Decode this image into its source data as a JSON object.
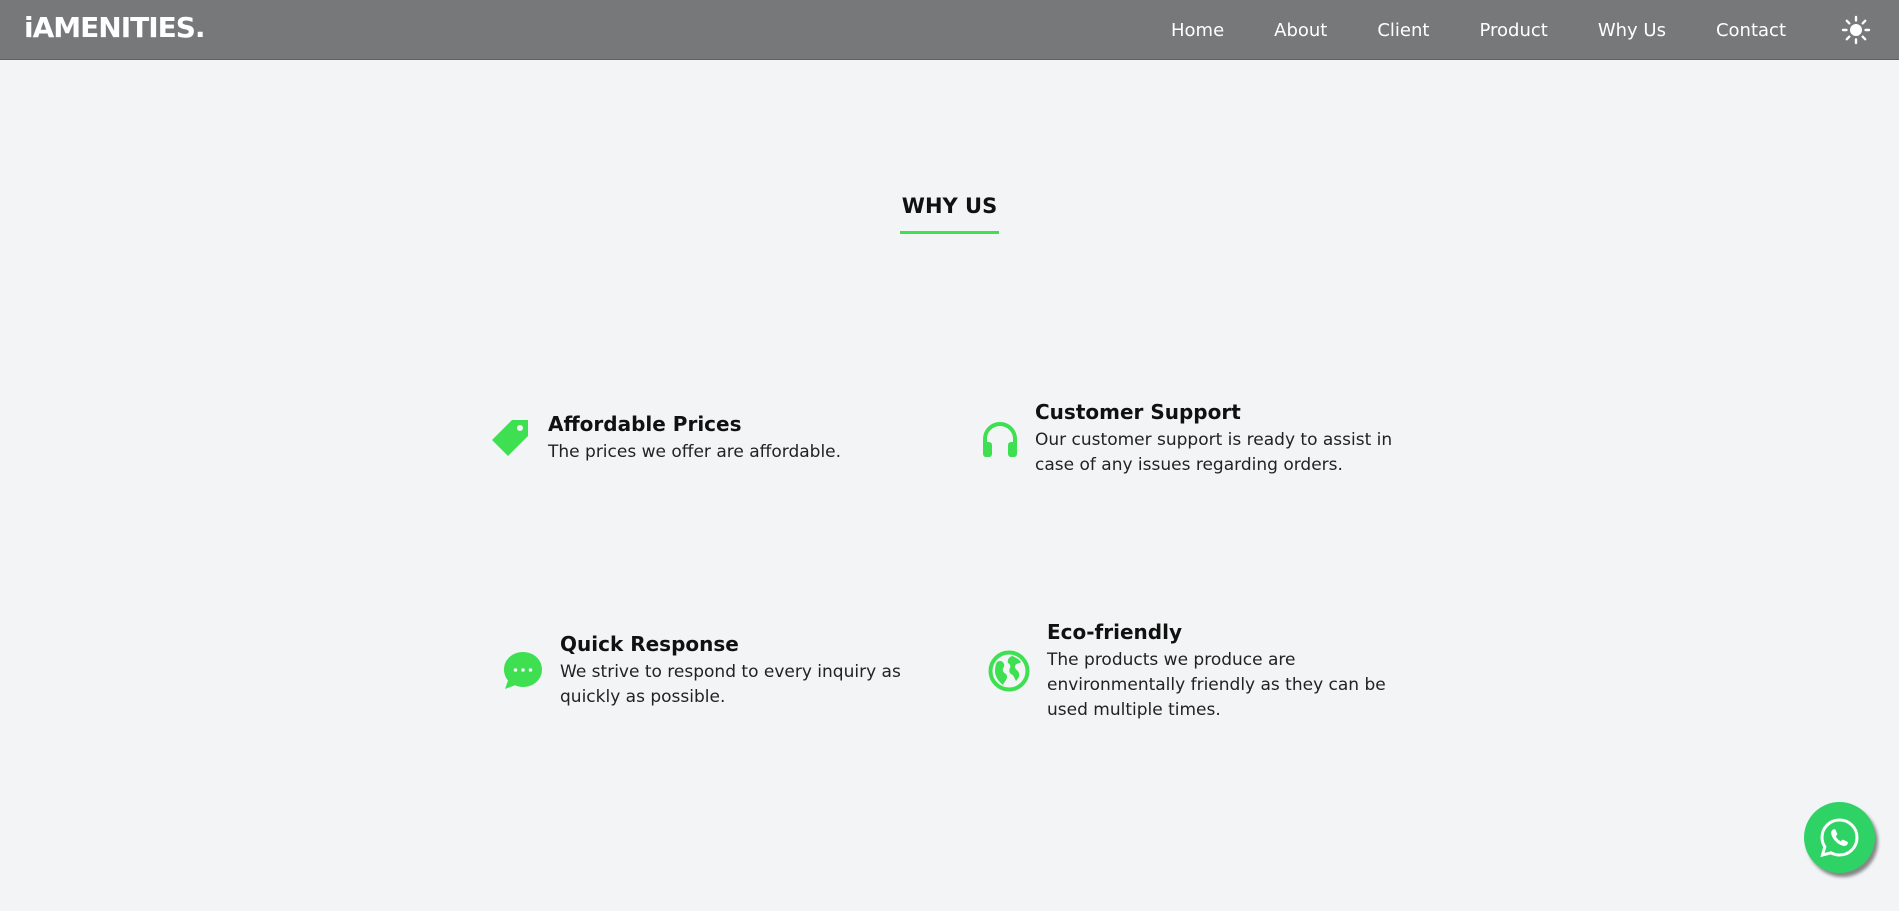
{
  "brand": {
    "logo_text": "iAMENITIES."
  },
  "nav": {
    "items": [
      {
        "label": "Home"
      },
      {
        "label": "About"
      },
      {
        "label": "Client"
      },
      {
        "label": "Product"
      },
      {
        "label": "Why Us"
      },
      {
        "label": "Contact"
      }
    ],
    "theme_toggle_icon": "sun-icon"
  },
  "section": {
    "title": "WHY US"
  },
  "features": [
    {
      "icon": "price-tag-icon",
      "title": "Affordable Prices",
      "description": "The prices we offer are affordable."
    },
    {
      "icon": "headphones-icon",
      "title": "Customer Support",
      "description": "Our customer support is ready to assist in case of any issues regarding orders."
    },
    {
      "icon": "chat-bubble-icon",
      "title": "Quick Response",
      "description": "We strive to respond to every inquiry as quickly as possible."
    },
    {
      "icon": "globe-icon",
      "title": "Eco-friendly",
      "description": "The products we produce are environmentally friendly as they can be used multiple times."
    }
  ],
  "floating": {
    "whatsapp_icon": "whatsapp-icon"
  },
  "colors": {
    "navbar_bg": "#77787a",
    "page_bg": "#f3f4f6",
    "accent_green": "#3ee052",
    "whatsapp_green": "#2fd365"
  }
}
